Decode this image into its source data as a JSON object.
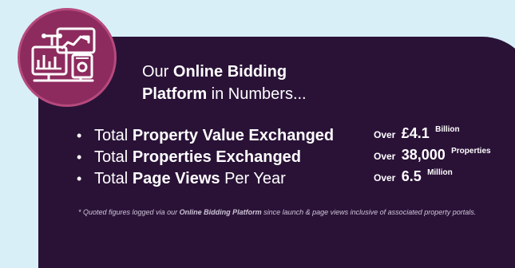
{
  "headline": {
    "line1_prefix": "Our ",
    "line1_bold": "Online Bidding",
    "line2_bold": "Platform",
    "line2_suffix": " in Numbers..."
  },
  "stats": [
    {
      "bullet": "•",
      "label_prefix": "Total ",
      "label_bold": "Property Value Exchanged",
      "label_suffix": "",
      "value_prefix": "Over",
      "value_main": "£4.1",
      "value_unit": "Billion"
    },
    {
      "bullet": "•",
      "label_prefix": "Total ",
      "label_bold": "Properties Exchanged",
      "label_suffix": "",
      "value_prefix": "Over",
      "value_main": "38,000",
      "value_unit": "Properties"
    },
    {
      "bullet": "•",
      "label_prefix": "Total ",
      "label_bold": "Page Views",
      "label_suffix": " Per Year",
      "value_prefix": "Over",
      "value_main": "6.5",
      "value_unit": "Million"
    }
  ],
  "footnote": {
    "prefix": "* Quoted figures logged via our ",
    "bold": "Online Bidding Platform",
    "suffix": " since launch & page views inclusive of associated property portals."
  },
  "icon": {
    "name": "analytics-dashboard-icon"
  },
  "colors": {
    "background": "#d8eff8",
    "panel": "#2a1237",
    "accent": "#8d2b5e",
    "accent_border": "#b7497d",
    "text": "#ffffff",
    "footnote": "#cfc4d8"
  }
}
